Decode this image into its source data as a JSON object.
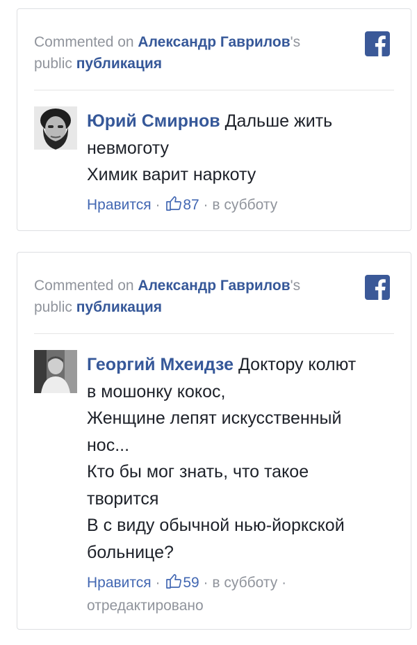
{
  "cards": [
    {
      "header": {
        "prefix": "Commented on ",
        "author": "Александр Гаврилов",
        "possessive": "'s",
        "public_word": "public ",
        "post_word": "публикация"
      },
      "logo_icon": "facebook-logo-icon",
      "comment": {
        "author": "Юрий Смирнов",
        "lines": [
          "Дальше жить",
          "невмоготу",
          "Химик варит наркоту"
        ]
      },
      "meta": {
        "like_label": "Нравится",
        "sep": " · ",
        "like_icon": "thumbs-up-icon",
        "like_count": "87",
        "time": "в субботу"
      }
    },
    {
      "header": {
        "prefix": "Commented on ",
        "author": "Александр Гаврилов",
        "possessive": "'s",
        "public_word": "public ",
        "post_word": "публикация"
      },
      "logo_icon": "facebook-logo-icon",
      "comment": {
        "author": "Георгий Мхеидзе",
        "lines": [
          "Доктору колют",
          "в мошонку кокос,",
          "Женщине лепят искусственный",
          "нос...",
          "Кто бы мог знать, что такое",
          "творится",
          "В с виду обычной нью-йоркской",
          "больнице?"
        ]
      },
      "meta": {
        "like_label": "Нравится",
        "sep": " · ",
        "like_icon": "thumbs-up-icon",
        "like_count": "59",
        "time": "в субботу",
        "edited": "отредактировано"
      }
    }
  ],
  "colors": {
    "link": "#365899",
    "muted": "#90949c",
    "like": "#4267b2",
    "fb_blue": "#3b5998"
  }
}
